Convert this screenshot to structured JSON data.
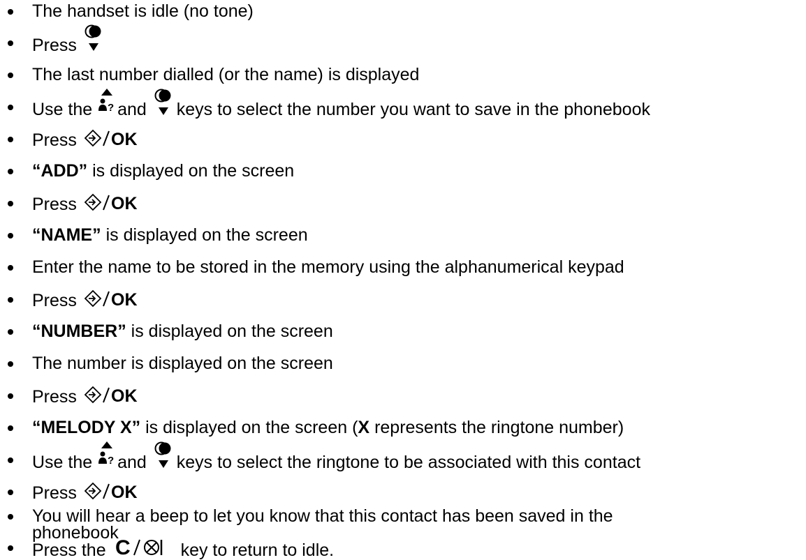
{
  "steps": [
    {
      "text": "The handset is idle (no tone)"
    },
    {
      "before": "Press"
    },
    {
      "text": "The last number dialled (or the name) is displayed"
    },
    {
      "before": "Use the",
      "mid": "and",
      "after": "keys to select the number you want to save in the phonebook"
    },
    {
      "before": "Press"
    },
    {
      "bold": "“ADD”",
      "after": "is displayed on the screen"
    },
    {
      "before": "Press"
    },
    {
      "bold": "“NAME”",
      "after": "is displayed on the screen"
    },
    {
      "text": "Enter the name to be stored in the memory using the alphanumerical keypad"
    },
    {
      "before": "Press"
    },
    {
      "bold": "“NUMBER”",
      "after": "is displayed on the screen"
    },
    {
      "text": "The number is displayed on the screen"
    },
    {
      "before": "Press"
    },
    {
      "bold": "“MELODY X”",
      "after1": "is displayed on the screen (",
      "bold2": "X",
      "after2": "represents the ringtone number)"
    },
    {
      "before": "Use the",
      "mid": "and",
      "after": "keys to select the ringtone to be associated with this contact"
    },
    {
      "before": "Press"
    },
    {
      "line1": "You will hear a beep to let you know that this contact has been saved in the",
      "line2": "phonebook"
    },
    {
      "before": "Press the",
      "after": "key to return to idle."
    }
  ],
  "icons": {
    "down": "phonebook-down-key-icon",
    "up": "redial-up-key-icon",
    "ok": "ok-key-icon",
    "ok_label": "OK",
    "clear": "clear-mute-key-icon",
    "clear_label": "C"
  }
}
